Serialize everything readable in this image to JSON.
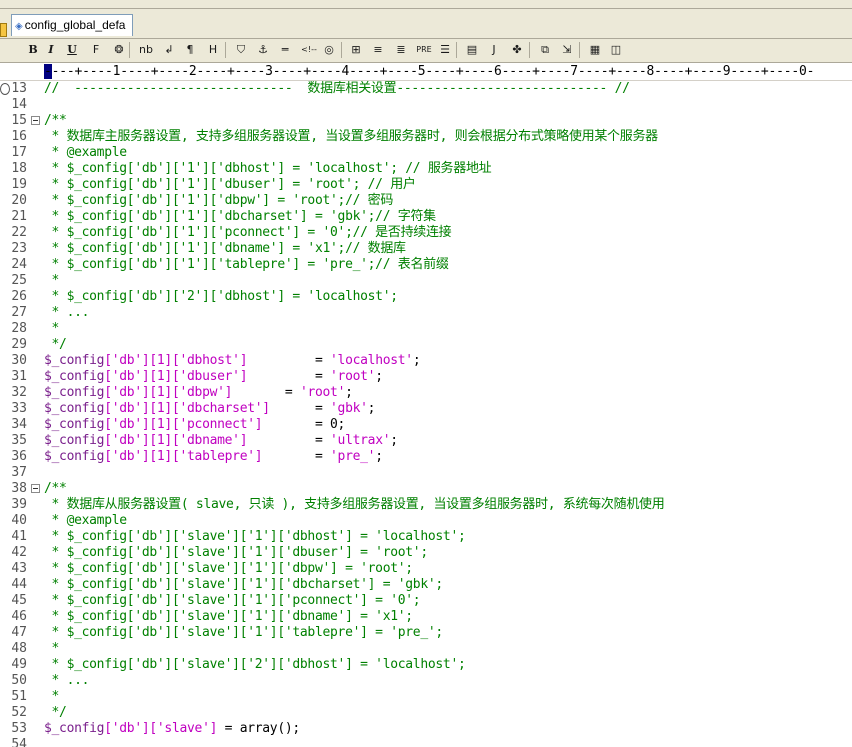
{
  "window": {
    "tab_title": "config_global_defa",
    "tab_icon": "document-icon"
  },
  "toolbar": {
    "buttons": [
      {
        "name": "bold-button",
        "label": "B"
      },
      {
        "name": "italic-button",
        "label": "I"
      },
      {
        "name": "underline-button",
        "label": "U"
      },
      {
        "name": "font-button",
        "label": "F"
      },
      {
        "name": "color-button",
        "label": "❂"
      },
      {
        "name": "nbsp-button",
        "label": "nb"
      },
      {
        "name": "linebreak-button",
        "label": "↲"
      },
      {
        "name": "paragraph-button",
        "label": "¶"
      },
      {
        "name": "heading-button",
        "label": "H"
      },
      {
        "name": "link-button",
        "label": "⛉"
      },
      {
        "name": "anchor-button",
        "label": "⚓"
      },
      {
        "name": "hr-button",
        "label": "═"
      },
      {
        "name": "comment-button",
        "label": "<!--"
      },
      {
        "name": "image-button",
        "label": "◎"
      },
      {
        "name": "table-button",
        "label": "⊞"
      },
      {
        "name": "center-button",
        "label": "≡"
      },
      {
        "name": "align-button",
        "label": "≣"
      },
      {
        "name": "pre-button",
        "label": "PRE"
      },
      {
        "name": "list-button",
        "label": "☰"
      },
      {
        "name": "form-button",
        "label": "▤"
      },
      {
        "name": "script-button",
        "label": "J"
      },
      {
        "name": "plugin-button",
        "label": "✤"
      },
      {
        "name": "copy-button",
        "label": "⧉"
      },
      {
        "name": "paste-button",
        "label": "⇲"
      },
      {
        "name": "colors-button",
        "label": "▦"
      },
      {
        "name": "window-button",
        "label": "◫"
      }
    ]
  },
  "ruler": {
    "text": "----+----1----+----2----+----3----+----4----+----5----+----6----+----7----+----8----+----9----+----0-"
  },
  "editor": {
    "lines": [
      {
        "n": "13",
        "fold": false,
        "tokens": [
          {
            "t": "//  -----------------------------  数据库相关设置---------------------------- //",
            "c": "c"
          }
        ]
      },
      {
        "n": "14",
        "fold": false,
        "tokens": []
      },
      {
        "n": "15",
        "fold": true,
        "tokens": [
          {
            "t": "/**",
            "c": "c"
          }
        ]
      },
      {
        "n": "16",
        "fold": false,
        "tokens": [
          {
            "t": " * 数据库主服务器设置, 支持多组服务器设置, 当设置多组服务器时, 则会根据分布式策略使用某个服务器",
            "c": "c"
          }
        ]
      },
      {
        "n": "17",
        "fold": false,
        "tokens": [
          {
            "t": " * @example",
            "c": "c"
          }
        ]
      },
      {
        "n": "18",
        "fold": false,
        "tokens": [
          {
            "t": " * $_config['db']['1']['dbhost'] = 'localhost'; // 服务器地址",
            "c": "c"
          }
        ]
      },
      {
        "n": "19",
        "fold": false,
        "tokens": [
          {
            "t": " * $_config['db']['1']['dbuser'] = 'root'; // 用户",
            "c": "c"
          }
        ]
      },
      {
        "n": "20",
        "fold": false,
        "tokens": [
          {
            "t": " * $_config['db']['1']['dbpw'] = 'root';// 密码",
            "c": "c"
          }
        ]
      },
      {
        "n": "21",
        "fold": false,
        "tokens": [
          {
            "t": " * $_config['db']['1']['dbcharset'] = 'gbk';// 字符集",
            "c": "c"
          }
        ]
      },
      {
        "n": "22",
        "fold": false,
        "tokens": [
          {
            "t": " * $_config['db']['1']['pconnect'] = '0';// 是否持续连接",
            "c": "c"
          }
        ]
      },
      {
        "n": "23",
        "fold": false,
        "tokens": [
          {
            "t": " * $_config['db']['1']['dbname'] = 'x1';// 数据库",
            "c": "c"
          }
        ]
      },
      {
        "n": "24",
        "fold": false,
        "tokens": [
          {
            "t": " * $_config['db']['1']['tablepre'] = 'pre_';// 表名前缀",
            "c": "c"
          }
        ]
      },
      {
        "n": "25",
        "fold": false,
        "tokens": [
          {
            "t": " *",
            "c": "c"
          }
        ]
      },
      {
        "n": "26",
        "fold": false,
        "tokens": [
          {
            "t": " * $_config['db']['2']['dbhost'] = 'localhost';",
            "c": "c"
          }
        ]
      },
      {
        "n": "27",
        "fold": false,
        "tokens": [
          {
            "t": " * ...",
            "c": "c"
          }
        ]
      },
      {
        "n": "28",
        "fold": false,
        "tokens": [
          {
            "t": " *",
            "c": "c"
          }
        ]
      },
      {
        "n": "29",
        "fold": false,
        "tokens": [
          {
            "t": " */",
            "c": "c"
          }
        ]
      },
      {
        "n": "30",
        "fold": false,
        "tokens": [
          {
            "t": "$_config",
            "c": "v"
          },
          {
            "t": "['db'][1]['dbhost']",
            "c": "s"
          },
          {
            "t": "         = ",
            "c": "k"
          },
          {
            "t": "'localhost'",
            "c": "s"
          },
          {
            "t": ";",
            "c": "k"
          }
        ]
      },
      {
        "n": "31",
        "fold": false,
        "tokens": [
          {
            "t": "$_config",
            "c": "v"
          },
          {
            "t": "['db'][1]['dbuser']",
            "c": "s"
          },
          {
            "t": "         = ",
            "c": "k"
          },
          {
            "t": "'root'",
            "c": "s"
          },
          {
            "t": ";",
            "c": "k"
          }
        ]
      },
      {
        "n": "32",
        "fold": false,
        "tokens": [
          {
            "t": "$_config",
            "c": "v"
          },
          {
            "t": "['db'][1]['dbpw']",
            "c": "s"
          },
          {
            "t": "       = ",
            "c": "k"
          },
          {
            "t": "'root'",
            "c": "s"
          },
          {
            "t": ";",
            "c": "k"
          }
        ]
      },
      {
        "n": "33",
        "fold": false,
        "tokens": [
          {
            "t": "$_config",
            "c": "v"
          },
          {
            "t": "['db'][1]['dbcharset']",
            "c": "s"
          },
          {
            "t": "      = ",
            "c": "k"
          },
          {
            "t": "'gbk'",
            "c": "s"
          },
          {
            "t": ";",
            "c": "k"
          }
        ]
      },
      {
        "n": "34",
        "fold": false,
        "tokens": [
          {
            "t": "$_config",
            "c": "v"
          },
          {
            "t": "['db'][1]['pconnect']",
            "c": "s"
          },
          {
            "t": "       = 0;",
            "c": "k"
          }
        ]
      },
      {
        "n": "35",
        "fold": false,
        "tokens": [
          {
            "t": "$_config",
            "c": "v"
          },
          {
            "t": "['db'][1]['dbname']",
            "c": "s"
          },
          {
            "t": "         = ",
            "c": "k"
          },
          {
            "t": "'ultrax'",
            "c": "s"
          },
          {
            "t": ";",
            "c": "k"
          }
        ]
      },
      {
        "n": "36",
        "fold": false,
        "tokens": [
          {
            "t": "$_config",
            "c": "v"
          },
          {
            "t": "['db'][1]['tablepre']",
            "c": "s"
          },
          {
            "t": "       = ",
            "c": "k"
          },
          {
            "t": "'pre_'",
            "c": "s"
          },
          {
            "t": ";",
            "c": "k"
          }
        ]
      },
      {
        "n": "37",
        "fold": false,
        "tokens": []
      },
      {
        "n": "38",
        "fold": true,
        "tokens": [
          {
            "t": "/**",
            "c": "c"
          }
        ]
      },
      {
        "n": "39",
        "fold": false,
        "tokens": [
          {
            "t": " * 数据库从服务器设置( slave, 只读 ), 支持多组服务器设置, 当设置多组服务器时, 系统每次随机使用",
            "c": "c"
          }
        ]
      },
      {
        "n": "40",
        "fold": false,
        "tokens": [
          {
            "t": " * @example",
            "c": "c"
          }
        ]
      },
      {
        "n": "41",
        "fold": false,
        "tokens": [
          {
            "t": " * $_config['db']['slave']['1']['dbhost'] = 'localhost';",
            "c": "c"
          }
        ]
      },
      {
        "n": "42",
        "fold": false,
        "tokens": [
          {
            "t": " * $_config['db']['slave']['1']['dbuser'] = 'root';",
            "c": "c"
          }
        ]
      },
      {
        "n": "43",
        "fold": false,
        "tokens": [
          {
            "t": " * $_config['db']['slave']['1']['dbpw'] = 'root';",
            "c": "c"
          }
        ]
      },
      {
        "n": "44",
        "fold": false,
        "tokens": [
          {
            "t": " * $_config['db']['slave']['1']['dbcharset'] = 'gbk';",
            "c": "c"
          }
        ]
      },
      {
        "n": "45",
        "fold": false,
        "tokens": [
          {
            "t": " * $_config['db']['slave']['1']['pconnect'] = '0';",
            "c": "c"
          }
        ]
      },
      {
        "n": "46",
        "fold": false,
        "tokens": [
          {
            "t": " * $_config['db']['slave']['1']['dbname'] = 'x1';",
            "c": "c"
          }
        ]
      },
      {
        "n": "47",
        "fold": false,
        "tokens": [
          {
            "t": " * $_config['db']['slave']['1']['tablepre'] = 'pre_';",
            "c": "c"
          }
        ]
      },
      {
        "n": "48",
        "fold": false,
        "tokens": [
          {
            "t": " *",
            "c": "c"
          }
        ]
      },
      {
        "n": "49",
        "fold": false,
        "tokens": [
          {
            "t": " * $_config['db']['slave']['2']['dbhost'] = 'localhost';",
            "c": "c"
          }
        ]
      },
      {
        "n": "50",
        "fold": false,
        "tokens": [
          {
            "t": " * ...",
            "c": "c"
          }
        ]
      },
      {
        "n": "51",
        "fold": false,
        "tokens": [
          {
            "t": " *",
            "c": "c"
          }
        ]
      },
      {
        "n": "52",
        "fold": false,
        "tokens": [
          {
            "t": " */",
            "c": "c"
          }
        ]
      },
      {
        "n": "53",
        "fold": false,
        "tokens": [
          {
            "t": "$_config",
            "c": "v"
          },
          {
            "t": "['db']['slave']",
            "c": "s"
          },
          {
            "t": " = array();",
            "c": "k"
          }
        ]
      },
      {
        "n": "54",
        "fold": false,
        "tokens": []
      }
    ]
  }
}
